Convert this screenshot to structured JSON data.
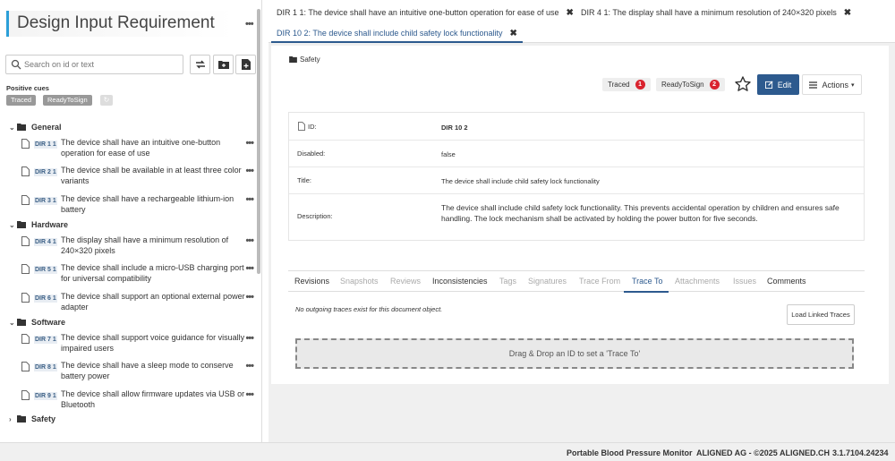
{
  "sidebar": {
    "title": "Design Input Requirement",
    "search_placeholder": "Search on id or text",
    "cues_label": "Positive cues",
    "cues": [
      "Traced",
      "ReadyToSign"
    ],
    "groups": [
      {
        "label": "General",
        "items": [
          {
            "id": "DIR 1 1",
            "text": "The device shall have an intuitive one-button operation for ease of use"
          },
          {
            "id": "DIR 2 1",
            "text": "The device shall be available in at least three color variants"
          },
          {
            "id": "DIR 3 1",
            "text": "The device shall have a rechargeable lithium-ion battery"
          }
        ]
      },
      {
        "label": "Hardware",
        "items": [
          {
            "id": "DIR 4 1",
            "text": "The display shall have a minimum resolution of 240×320 pixels"
          },
          {
            "id": "DIR 5 1",
            "text": "The device shall include a micro-USB charging port for universal compatibility"
          },
          {
            "id": "DIR 6 1",
            "text": "The device shall support an optional external power adapter"
          }
        ]
      },
      {
        "label": "Software",
        "items": [
          {
            "id": "DIR 7 1",
            "text": "The device shall support voice guidance for visually impaired users"
          },
          {
            "id": "DIR 8 1",
            "text": "The device shall have a sleep mode to conserve battery power"
          },
          {
            "id": "DIR 9 1",
            "text": "The device shall allow firmware updates via USB or Bluetooth"
          }
        ]
      },
      {
        "label": "Safety",
        "items": []
      }
    ]
  },
  "open_tabs": [
    {
      "label": "DIR 1 1: The device shall have an intuitive one-button operation for ease of use"
    },
    {
      "label": "DIR 4 1: The display shall have a minimum resolution of 240×320 pixels"
    },
    {
      "label": "DIR 10 2: The device shall include child safety lock functionality"
    }
  ],
  "document": {
    "breadcrumb": "Safety",
    "statuses": [
      {
        "label": "Traced",
        "count": "1"
      },
      {
        "label": "ReadyToSign",
        "count": "2"
      }
    ],
    "edit_label": "Edit",
    "actions_label": "Actions",
    "fields": [
      {
        "label": "ID:",
        "value": "DIR 10 2"
      },
      {
        "label": "Disabled:",
        "value": "false"
      },
      {
        "label": "Title:",
        "value": "The device shall include child safety lock functionality"
      },
      {
        "label": "Description:",
        "value": "The device shall include child safety lock functionality. This prevents accidental operation by children and ensures safe handling. The lock mechanism shall be activated by holding the power button for five seconds."
      }
    ],
    "tabs": [
      "Revisions",
      "Snapshots",
      "Reviews",
      "Inconsistencies",
      "Tags",
      "Signatures",
      "Trace From",
      "Trace To",
      "Attachments",
      "Issues",
      "Comments"
    ],
    "no_traces_text": "No outgoing traces exist for this document object.",
    "load_button": "Load Linked Traces",
    "dropzone_text": "Drag & Drop an ID to set a 'Trace To'"
  },
  "footer": {
    "project": "Portable Blood Pressure Monitor",
    "company": "ALIGNED AG - ©2025 ALIGNED.CH",
    "version": "3.1.7104.24234"
  },
  "colors": {
    "accent": "#2d5a8e",
    "badge": "#d9232e",
    "title_bar": "#2b9fd8"
  }
}
